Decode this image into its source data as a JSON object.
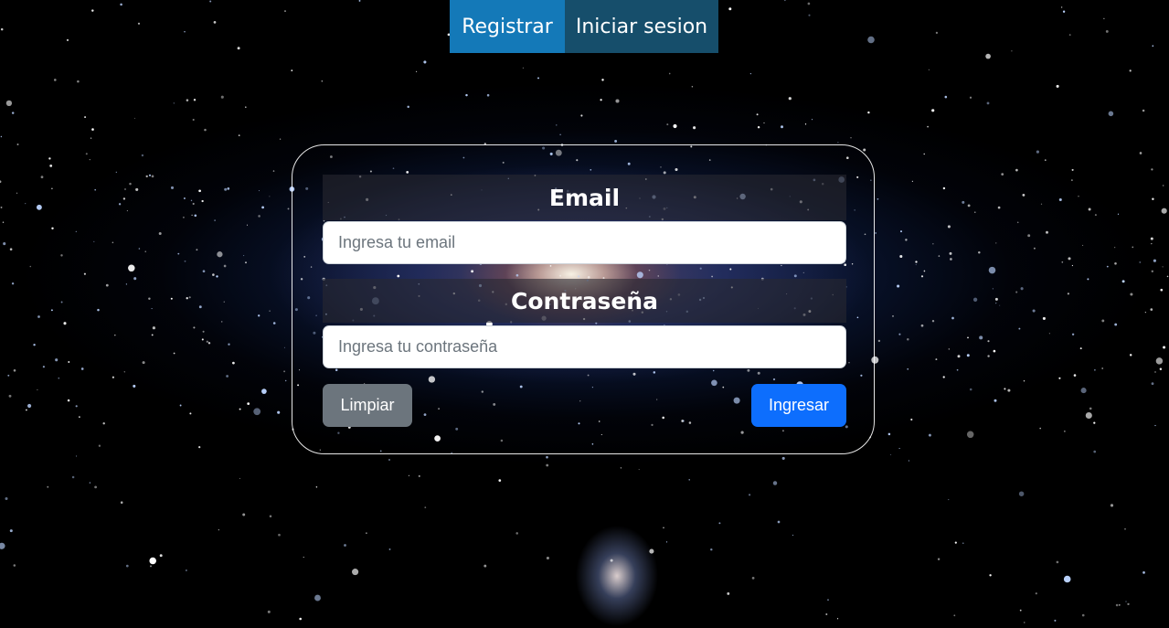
{
  "nav": {
    "register_label": "Registrar",
    "login_label": "Iniciar sesion"
  },
  "form": {
    "email_label": "Email",
    "email_placeholder": "Ingresa tu email",
    "email_value": "",
    "password_label": "Contraseña",
    "password_placeholder": "Ingresa tu contraseña",
    "password_value": "",
    "clear_label": "Limpiar",
    "submit_label": "Ingresar"
  },
  "colors": {
    "register_tab": "#1479b8",
    "login_tab": "#164e6b",
    "clear_button": "#6c757d",
    "submit_button": "#0d6efd"
  }
}
